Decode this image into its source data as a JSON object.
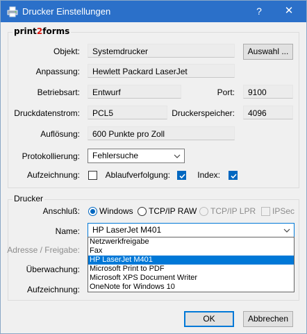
{
  "window": {
    "title": "Drucker Einstellungen",
    "help_glyph": "?",
    "close_glyph": "✕"
  },
  "colors": {
    "titlebar": "#2b70c9",
    "accent": "#0078d7",
    "brand_red": "#d9140f"
  },
  "print2forms_group": {
    "brand_prefix": "print",
    "brand_digit": "2",
    "brand_suffix": "forms",
    "objekt": {
      "label": "Objekt:",
      "value": "Systemdrucker"
    },
    "auswahl_button": "Auswahl ...",
    "anpassung": {
      "label": "Anpassung:",
      "value": "Hewlett Packard LaserJet"
    },
    "betriebsart": {
      "label": "Betriebsart:",
      "value": "Entwurf"
    },
    "port": {
      "label": "Port:",
      "value": "9100"
    },
    "druckdatenstrom": {
      "label": "Druckdatenstrom:",
      "value": "PCL5"
    },
    "druckerspeicher": {
      "label": "Druckerspeicher:",
      "value": "4096"
    },
    "aufloesung": {
      "label": "Auflösung:",
      "value": "600 Punkte pro Zoll"
    },
    "protokollierung": {
      "label": "Protokollierung:",
      "value": "Fehlersuche"
    },
    "aufzeichnung": {
      "label": "Aufzeichnung:",
      "checked": false
    },
    "ablaufverfolgung": {
      "label": "Ablaufverfolgung:",
      "checked": true
    },
    "index": {
      "label": "Index:",
      "checked": true
    }
  },
  "drucker_group": {
    "title": "Drucker",
    "anschluss_label": "Anschluß:",
    "anschluss_options": [
      {
        "label": "Windows",
        "selected": true,
        "enabled": true
      },
      {
        "label": "TCP/IP RAW",
        "selected": false,
        "enabled": true
      },
      {
        "label": "TCP/IP LPR",
        "selected": false,
        "enabled": false
      }
    ],
    "ipsec": {
      "label": "IPSec",
      "checked": false,
      "enabled": false
    },
    "name": {
      "label": "Name:",
      "value": "HP LaserJet M401"
    },
    "adresse_label": "Adresse / Freigabe:",
    "ueberwachung_label": "Überwachung:",
    "aufzeichnung_label": "Aufzeichnung:",
    "dropdown_items": [
      "Netzwerkfreigabe",
      "Fax",
      "HP LaserJet M401",
      "Microsoft Print to PDF",
      "Microsoft XPS Document Writer",
      "OneNote for Windows 10"
    ],
    "dropdown_selected_index": 2
  },
  "buttons": {
    "ok": "OK",
    "cancel": "Abbrechen"
  }
}
